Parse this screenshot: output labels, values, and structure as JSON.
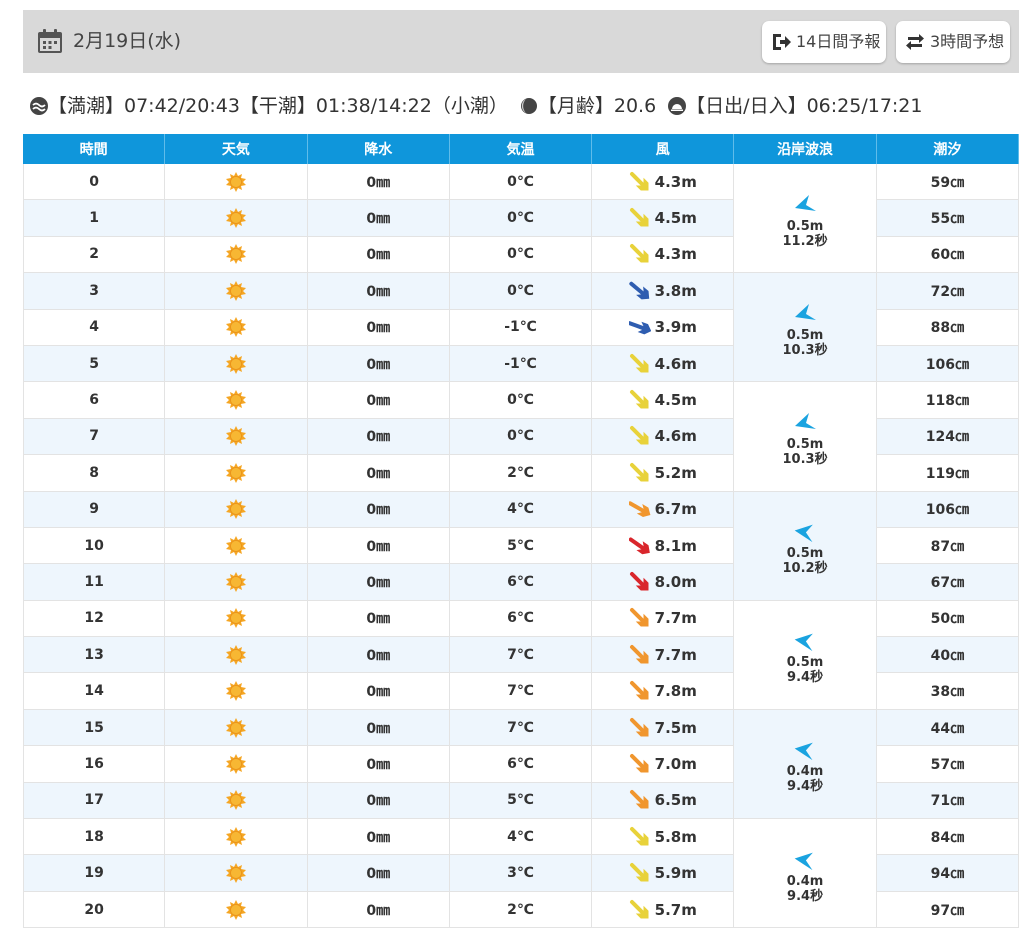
{
  "header": {
    "date": "2月19日(水)",
    "btn14": "14日間予報",
    "btn3": "3時間予想"
  },
  "info": {
    "tide_high": "【満潮】07:42/20:43",
    "tide_low": "【干潮】01:38/14:22",
    "tide_type": "（小潮）",
    "moon_age": "【月齢】20.6",
    "sun": "【日出/日入】06:25/17:21"
  },
  "table": {
    "headers": [
      "時間",
      "天気",
      "降水",
      "気温",
      "風",
      "沿岸波浪",
      "潮汐"
    ],
    "rows": [
      {
        "hour": "0",
        "weather": "sunny",
        "precip": "0㎜",
        "temp": "0℃",
        "wind": "4.3m",
        "wind_color": "#e8d23a",
        "wind_angle": 0,
        "tide": "59㎝"
      },
      {
        "hour": "1",
        "weather": "sunny",
        "precip": "0㎜",
        "temp": "0℃",
        "wind": "4.5m",
        "wind_color": "#e8d23a",
        "wind_angle": 0,
        "tide": "55㎝"
      },
      {
        "hour": "2",
        "weather": "sunny",
        "precip": "0㎜",
        "temp": "0℃",
        "wind": "4.3m",
        "wind_color": "#e8d23a",
        "wind_angle": 0,
        "tide": "60㎝"
      },
      {
        "hour": "3",
        "weather": "sunny",
        "precip": "0㎜",
        "temp": "0℃",
        "wind": "3.8m",
        "wind_color": "#2f5db0",
        "wind_angle": -5,
        "tide": "72㎝"
      },
      {
        "hour": "4",
        "weather": "sunny",
        "precip": "0㎜",
        "temp": "-1℃",
        "wind": "3.9m",
        "wind_color": "#2f5db0",
        "wind_angle": -25,
        "tide": "88㎝"
      },
      {
        "hour": "5",
        "weather": "sunny",
        "precip": "0㎜",
        "temp": "-1℃",
        "wind": "4.6m",
        "wind_color": "#e8d23a",
        "wind_angle": 0,
        "tide": "106㎝"
      },
      {
        "hour": "6",
        "weather": "sunny",
        "precip": "0㎜",
        "temp": "0℃",
        "wind": "4.5m",
        "wind_color": "#e8d23a",
        "wind_angle": 0,
        "tide": "118㎝"
      },
      {
        "hour": "7",
        "weather": "sunny",
        "precip": "0㎜",
        "temp": "0℃",
        "wind": "4.6m",
        "wind_color": "#e8d23a",
        "wind_angle": 0,
        "tide": "124㎝"
      },
      {
        "hour": "8",
        "weather": "sunny",
        "precip": "0㎜",
        "temp": "2℃",
        "wind": "5.2m",
        "wind_color": "#e8d23a",
        "wind_angle": 0,
        "tide": "119㎝"
      },
      {
        "hour": "9",
        "weather": "sunny",
        "precip": "0㎜",
        "temp": "4℃",
        "wind": "6.7m",
        "wind_color": "#f0962e",
        "wind_angle": -15,
        "tide": "106㎝"
      },
      {
        "hour": "10",
        "weather": "sunny",
        "precip": "0㎜",
        "temp": "5℃",
        "wind": "8.1m",
        "wind_color": "#d9262c",
        "wind_angle": -10,
        "tide": "87㎝"
      },
      {
        "hour": "11",
        "weather": "sunny",
        "precip": "0㎜",
        "temp": "6℃",
        "wind": "8.0m",
        "wind_color": "#d9262c",
        "wind_angle": 0,
        "tide": "67㎝"
      },
      {
        "hour": "12",
        "weather": "sunny",
        "precip": "0㎜",
        "temp": "6℃",
        "wind": "7.7m",
        "wind_color": "#f0962e",
        "wind_angle": 0,
        "tide": "50㎝"
      },
      {
        "hour": "13",
        "weather": "sunny",
        "precip": "0㎜",
        "temp": "7℃",
        "wind": "7.7m",
        "wind_color": "#f0962e",
        "wind_angle": 0,
        "tide": "40㎝"
      },
      {
        "hour": "14",
        "weather": "sunny",
        "precip": "0㎜",
        "temp": "7℃",
        "wind": "7.8m",
        "wind_color": "#f0962e",
        "wind_angle": 0,
        "tide": "38㎝"
      },
      {
        "hour": "15",
        "weather": "sunny",
        "precip": "0㎜",
        "temp": "7℃",
        "wind": "7.5m",
        "wind_color": "#f0962e",
        "wind_angle": 0,
        "tide": "44㎝"
      },
      {
        "hour": "16",
        "weather": "sunny",
        "precip": "0㎜",
        "temp": "6℃",
        "wind": "7.0m",
        "wind_color": "#f0962e",
        "wind_angle": 0,
        "tide": "57㎝"
      },
      {
        "hour": "17",
        "weather": "sunny",
        "precip": "0㎜",
        "temp": "5℃",
        "wind": "6.5m",
        "wind_color": "#f0962e",
        "wind_angle": 0,
        "tide": "71㎝"
      },
      {
        "hour": "18",
        "weather": "sunny",
        "precip": "0㎜",
        "temp": "4℃",
        "wind": "5.8m",
        "wind_color": "#e8d23a",
        "wind_angle": 0,
        "tide": "84㎝"
      },
      {
        "hour": "19",
        "weather": "sunny",
        "precip": "0㎜",
        "temp": "3℃",
        "wind": "5.9m",
        "wind_color": "#e8d23a",
        "wind_angle": 0,
        "tide": "94㎝"
      },
      {
        "hour": "20",
        "weather": "sunny",
        "precip": "0㎜",
        "temp": "2℃",
        "wind": "5.7m",
        "wind_color": "#e8d23a",
        "wind_angle": 0,
        "tide": "97㎝"
      }
    ],
    "waves": [
      {
        "height": "0.5m",
        "period": "11.2秒",
        "angle": 0
      },
      {
        "height": "0.5m",
        "period": "10.3秒",
        "angle": 0
      },
      {
        "height": "0.5m",
        "period": "10.3秒",
        "angle": 0
      },
      {
        "height": "0.5m",
        "period": "10.2秒",
        "angle": 25
      },
      {
        "height": "0.5m",
        "period": "9.4秒",
        "angle": 25
      },
      {
        "height": "0.4m",
        "period": "9.4秒",
        "angle": 25
      },
      {
        "height": "0.4m",
        "period": "9.4秒",
        "angle": 25
      }
    ]
  },
  "colors": {
    "header_bg": "#0f96db",
    "row_alt": "#eef6fd",
    "sun": "#f5a623",
    "wave_arrow": "#1aa3e0"
  }
}
